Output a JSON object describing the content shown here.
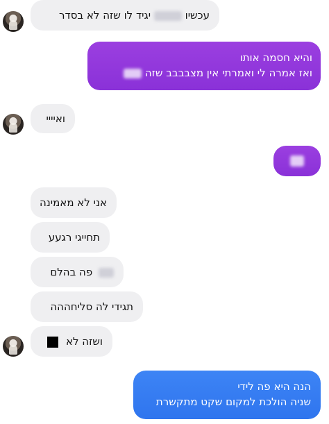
{
  "thread": {
    "msg1": {
      "text_start": "עכשיו",
      "text_end": "יגיד לו שזה לא בסדר"
    },
    "msg2": {
      "line1": "והיא חסמה אותו",
      "line2": "ואז אמרה לי ואמרתי אין מצבבבב שזה"
    },
    "msg3": {
      "text": "ואיייי"
    },
    "msg5": {
      "text": "אני לא מאמינה"
    },
    "msg6": {
      "text": "תחייגי רגעע"
    },
    "msg7": {
      "text": "פה בהלם"
    },
    "msg8": {
      "text": "תגידי לה סליחההה"
    },
    "msg9": {
      "text": "ושזה לא"
    },
    "msg10": {
      "line1": "הנה היא פה לידי",
      "line2": "שניה הולכת למקום שקט מתקשרת"
    }
  },
  "colors": {
    "incoming_bg": "#efeff1",
    "outgoing_purple": "#8a31d8",
    "outgoing_blue": "#2f75ee"
  }
}
